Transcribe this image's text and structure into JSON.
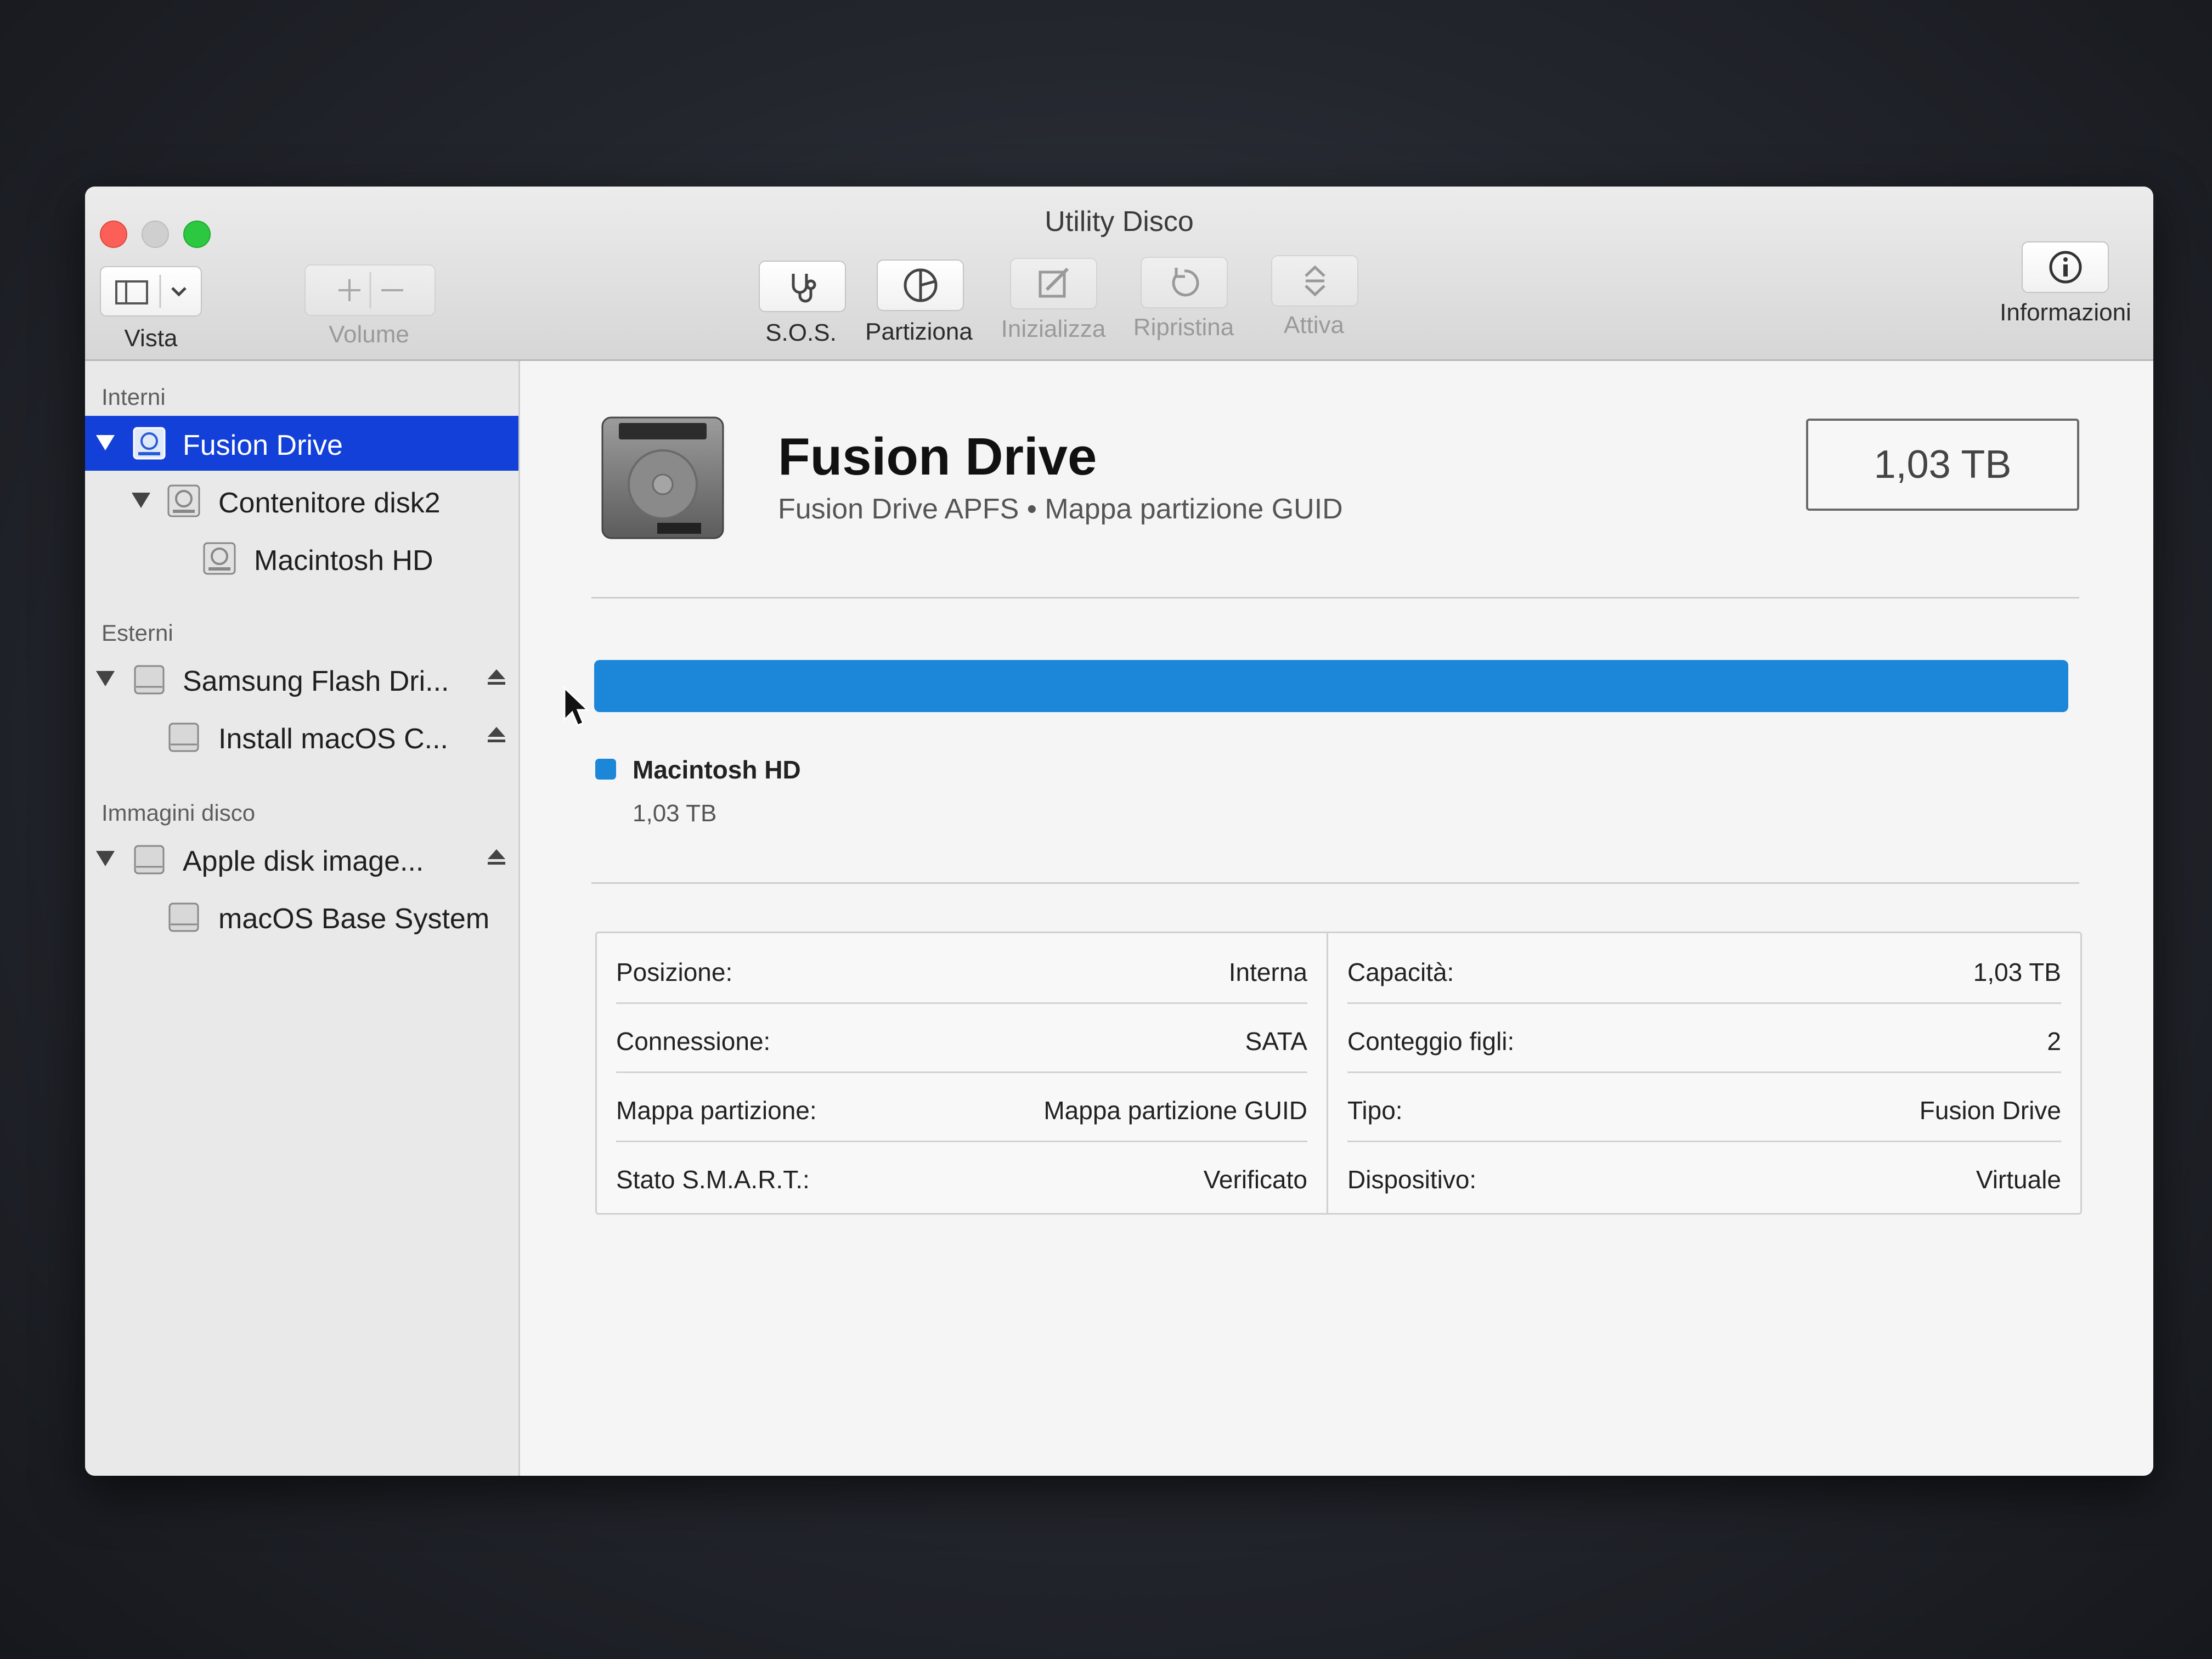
{
  "window": {
    "title": "Utility Disco"
  },
  "toolbar": {
    "view_label": "Vista",
    "volume_label": "Volume",
    "sos_label": "S.O.S.",
    "partition_label": "Partiziona",
    "erase_label": "Inizializza",
    "restore_label": "Ripristina",
    "mount_label": "Attiva",
    "info_label": "Informazioni"
  },
  "sidebar": {
    "internal_header": "Interni",
    "external_header": "Esterni",
    "images_header": "Immagini disco",
    "items": {
      "fusion": "Fusion Drive",
      "container": "Contenitore disk2",
      "macintosh": "Macintosh HD",
      "samsung": "Samsung Flash Dri...",
      "install": "Install macOS C...",
      "apple_image": "Apple disk image...",
      "base_system": "macOS Base System"
    }
  },
  "main": {
    "disk_name": "Fusion Drive",
    "disk_subtitle": "Fusion Drive APFS • Mappa partizione GUID",
    "capacity": "1,03 TB",
    "usage": {
      "fill_fraction": 1.0,
      "color": "#1c86d8",
      "volume_name": "Macintosh HD",
      "volume_size": "1,03 TB"
    }
  },
  "info": {
    "left": [
      {
        "label": "Posizione:",
        "value": "Interna"
      },
      {
        "label": "Connessione:",
        "value": "SATA"
      },
      {
        "label": "Mappa partizione:",
        "value": "Mappa partizione GUID"
      },
      {
        "label": "Stato S.M.A.R.T.:",
        "value": "Verificato"
      }
    ],
    "right": [
      {
        "label": "Capacità:",
        "value": "1,03 TB"
      },
      {
        "label": "Conteggio figli:",
        "value": "2"
      },
      {
        "label": "Tipo:",
        "value": "Fusion Drive"
      },
      {
        "label": "Dispositivo:",
        "value": "Virtuale"
      }
    ]
  }
}
